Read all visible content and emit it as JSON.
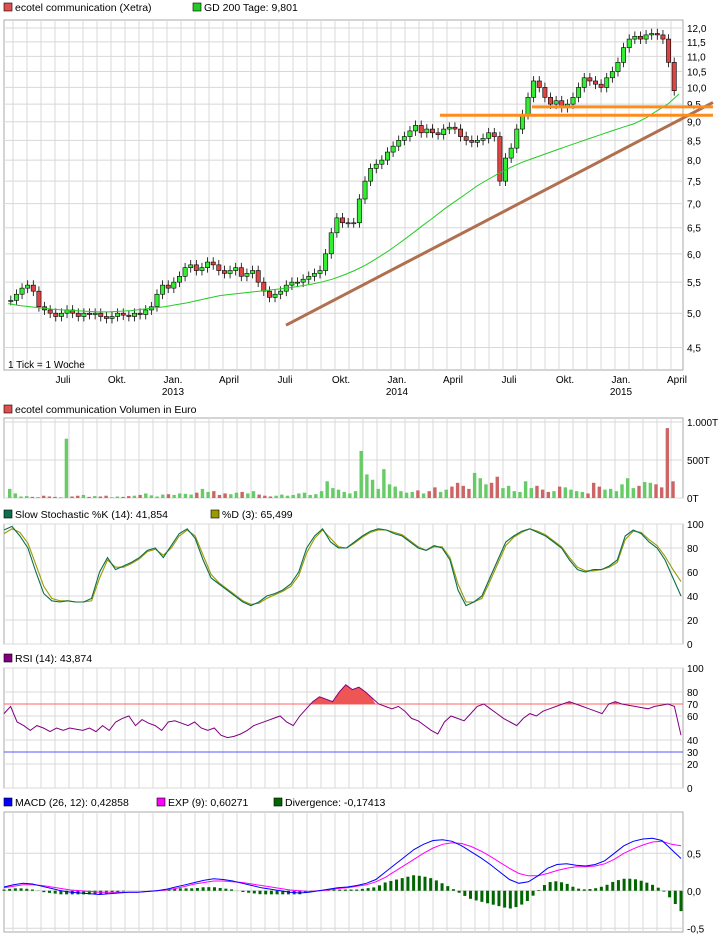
{
  "chart_data": [
    {
      "id": "price",
      "type": "candlestick",
      "legend": [
        {
          "label": "ecotel communication (Xetra)",
          "color": "#e05050"
        },
        {
          "label": "GD 200 Tage: 9,801",
          "color": "#22cc22"
        }
      ],
      "footnote": "1 Tick = 1 Woche",
      "y_scale": "log",
      "ylim": [
        4.2,
        12.3
      ],
      "y_ticks": [
        "12,0",
        "11,5",
        "11,0",
        "10,5",
        "10,0",
        "9,5",
        "9,0",
        "8,5",
        "8,0",
        "7,5",
        "7,0",
        "6,5",
        "6,0",
        "5,5",
        "5,0",
        "4,5"
      ],
      "x_month_labels": [
        "Juli",
        "Okt.",
        "Jan.",
        "April",
        "Juli",
        "Okt.",
        "Jan.",
        "April",
        "Juli",
        "Okt.",
        "Jan.",
        "April"
      ],
      "x_year_labels": [
        "2013",
        "2014",
        "2015"
      ],
      "close_series": [
        5.2,
        5.3,
        5.4,
        5.45,
        5.35,
        5.1,
        5.05,
        5.0,
        4.95,
        5.0,
        5.05,
        5.0,
        4.95,
        5.0,
        4.98,
        5.0,
        4.95,
        4.92,
        4.95,
        5.0,
        4.97,
        4.95,
        5.0,
        4.98,
        5.05,
        5.1,
        5.3,
        5.45,
        5.4,
        5.5,
        5.6,
        5.75,
        5.8,
        5.7,
        5.75,
        5.85,
        5.8,
        5.7,
        5.65,
        5.7,
        5.75,
        5.6,
        5.65,
        5.7,
        5.5,
        5.35,
        5.25,
        5.3,
        5.35,
        5.45,
        5.5,
        5.5,
        5.55,
        5.6,
        5.65,
        5.7,
        6.0,
        6.4,
        6.7,
        6.6,
        6.6,
        6.6,
        7.1,
        7.5,
        7.8,
        7.9,
        8.0,
        8.2,
        8.35,
        8.5,
        8.6,
        8.75,
        8.9,
        8.7,
        8.8,
        8.7,
        8.65,
        8.8,
        8.85,
        8.8,
        8.6,
        8.5,
        8.45,
        8.5,
        8.55,
        8.7,
        8.6,
        7.5,
        8.05,
        8.3,
        8.8,
        9.2,
        9.7,
        10.2,
        10.0,
        9.7,
        9.5,
        9.6,
        9.4,
        9.5,
        9.7,
        10.0,
        10.3,
        10.2,
        10.1,
        10.0,
        10.3,
        10.5,
        10.8,
        11.3,
        11.6,
        11.7,
        11.6,
        11.75,
        11.8,
        11.75,
        11.6,
        10.8,
        9.9
      ],
      "gd200_series": [
        5.15,
        5.12,
        5.1,
        5.08,
        5.06,
        5.05,
        5.04,
        5.03,
        5.02,
        5.02,
        5.03,
        5.04,
        5.06,
        5.08,
        5.1,
        5.13,
        5.16,
        5.2,
        5.24,
        5.28,
        5.3,
        5.32,
        5.34,
        5.36,
        5.38,
        5.4,
        5.43,
        5.46,
        5.5,
        5.55,
        5.62,
        5.7,
        5.8,
        5.92,
        6.05,
        6.2,
        6.36,
        6.53,
        6.7,
        6.88,
        7.05,
        7.22,
        7.4,
        7.55,
        7.7,
        7.83,
        7.95,
        8.05,
        8.15,
        8.25,
        8.35,
        8.45,
        8.55,
        8.65,
        8.75,
        8.85,
        8.95,
        9.1,
        9.3,
        9.5,
        9.8
      ],
      "annotations": [
        {
          "label": "support-1",
          "x0": 0.0,
          "y0": 4.8,
          "x1": 1.0,
          "y1": 9.2
        },
        {
          "label": "resistance-1",
          "y": 9.2
        },
        {
          "label": "resistance-2",
          "y": 9.4
        }
      ]
    },
    {
      "id": "volume",
      "type": "bar",
      "legend": [
        {
          "label": "ecotel communication Volumen in Euro",
          "color": "#e05050"
        }
      ],
      "y_ticks": [
        "1.000T",
        "500T",
        "0T"
      ],
      "ylim": [
        0,
        1000
      ],
      "values": [
        120,
        60,
        20,
        25,
        15,
        10,
        30,
        20,
        15,
        10,
        780,
        20,
        30,
        40,
        15,
        25,
        20,
        30,
        10,
        20,
        15,
        25,
        30,
        40,
        60,
        35,
        20,
        45,
        50,
        40,
        60,
        55,
        45,
        70,
        120,
        80,
        90,
        40,
        60,
        50,
        70,
        80,
        60,
        90,
        45,
        30,
        20,
        30,
        45,
        30,
        40,
        60,
        70,
        40,
        50,
        90,
        220,
        130,
        110,
        80,
        60,
        90,
        620,
        310,
        240,
        120,
        380,
        180,
        150,
        90,
        70,
        80,
        100,
        60,
        90,
        140,
        80,
        110,
        150,
        200,
        160,
        120,
        330,
        260,
        180,
        200,
        280,
        130,
        160,
        90,
        80,
        220,
        130,
        160,
        110,
        80,
        90,
        150,
        140,
        110,
        90,
        80,
        60,
        200,
        150,
        110,
        120,
        90,
        180,
        260,
        130,
        160,
        210,
        200,
        180,
        140,
        920,
        220
      ],
      "colors_up": "#66cc66",
      "colors_down": "#cc6666"
    },
    {
      "id": "stochastic",
      "type": "line",
      "legend": [
        {
          "label": "Slow Stochastic %K (14): 41,854",
          "color": "#0b6e4f"
        },
        {
          "label": "%D (3): 65,499",
          "color": "#999900"
        }
      ],
      "ylim": [
        0,
        100
      ],
      "y_ticks": [
        "100",
        "80",
        "60",
        "40",
        "20",
        "0"
      ],
      "k_series": [
        95,
        98,
        90,
        80,
        60,
        42,
        36,
        35,
        36,
        35,
        35,
        38,
        60,
        72,
        62,
        65,
        68,
        72,
        78,
        80,
        72,
        82,
        92,
        96,
        88,
        70,
        55,
        50,
        45,
        40,
        35,
        32,
        35,
        40,
        42,
        45,
        50,
        60,
        80,
        90,
        96,
        85,
        80,
        80,
        85,
        90,
        94,
        96,
        95,
        92,
        90,
        85,
        80,
        78,
        82,
        80,
        70,
        45,
        32,
        35,
        40,
        55,
        70,
        85,
        90,
        94,
        96,
        93,
        90,
        85,
        80,
        70,
        62,
        60,
        62,
        62,
        65,
        70,
        90,
        95,
        92,
        85,
        80,
        70,
        55,
        40
      ],
      "d_series": [
        92,
        96,
        93,
        84,
        66,
        48,
        38,
        36,
        36,
        35,
        35,
        36,
        55,
        70,
        64,
        64,
        67,
        71,
        77,
        79,
        74,
        80,
        90,
        95,
        90,
        74,
        58,
        51,
        46,
        41,
        36,
        33,
        34,
        38,
        41,
        44,
        48,
        57,
        76,
        88,
        95,
        88,
        81,
        80,
        84,
        89,
        93,
        95,
        95,
        93,
        91,
        86,
        81,
        78,
        81,
        81,
        72,
        50,
        35,
        35,
        38,
        52,
        67,
        82,
        89,
        93,
        96,
        94,
        91,
        86,
        81,
        72,
        64,
        61,
        61,
        62,
        64,
        68,
        87,
        94,
        93,
        87,
        82,
        73,
        62,
        52
      ]
    },
    {
      "id": "rsi",
      "type": "line",
      "legend": [
        {
          "label": "RSI (14): 43,874",
          "color": "#800080"
        }
      ],
      "ylim": [
        0,
        100
      ],
      "y_ticks": [
        "100",
        "80",
        "70",
        "60",
        "40",
        "30",
        "20",
        "0"
      ],
      "upper_band": 70,
      "lower_band": 30,
      "series": [
        62,
        68,
        55,
        52,
        48,
        52,
        50,
        47,
        50,
        48,
        50,
        49,
        48,
        50,
        47,
        52,
        48,
        55,
        58,
        60,
        52,
        57,
        54,
        52,
        48,
        55,
        56,
        54,
        52,
        55,
        50,
        48,
        50,
        44,
        42,
        43,
        45,
        48,
        52,
        54,
        56,
        58,
        60,
        55,
        52,
        60,
        66,
        72,
        76,
        74,
        72,
        80,
        86,
        82,
        84,
        80,
        75,
        70,
        68,
        66,
        68,
        64,
        58,
        56,
        52,
        48,
        45,
        55,
        60,
        58,
        56,
        62,
        68,
        70,
        66,
        62,
        58,
        55,
        52,
        58,
        62,
        60,
        64,
        66,
        68,
        70,
        72,
        70,
        68,
        66,
        64,
        62,
        70,
        72,
        70,
        69,
        68,
        67,
        66,
        68,
        69,
        70,
        68,
        44
      ]
    },
    {
      "id": "macd",
      "type": "line",
      "legend": [
        {
          "label": "MACD (26, 12): 0,42858",
          "color": "#0000ff"
        },
        {
          "label": "EXP (9): 0,60271",
          "color": "#ff00ff"
        },
        {
          "label": "Divergence: -0,17413",
          "color": "#006600"
        }
      ],
      "ylim": [
        -0.55,
        1.05
      ],
      "y_ticks": [
        "0,5",
        "0,0",
        "-0,5"
      ],
      "macd_series": [
        0.05,
        0.08,
        0.1,
        0.09,
        0.06,
        0.03,
        0.0,
        -0.02,
        -0.03,
        -0.04,
        -0.05,
        -0.04,
        -0.03,
        -0.02,
        -0.02,
        -0.01,
        0.0,
        0.02,
        0.05,
        0.08,
        0.11,
        0.14,
        0.16,
        0.15,
        0.13,
        0.1,
        0.07,
        0.04,
        0.02,
        0.0,
        -0.02,
        -0.03,
        -0.02,
        0.0,
        0.02,
        0.04,
        0.05,
        0.07,
        0.1,
        0.15,
        0.25,
        0.35,
        0.45,
        0.55,
        0.62,
        0.67,
        0.68,
        0.66,
        0.6,
        0.52,
        0.44,
        0.35,
        0.25,
        0.15,
        0.1,
        0.12,
        0.2,
        0.3,
        0.35,
        0.36,
        0.34,
        0.33,
        0.35,
        0.4,
        0.5,
        0.6,
        0.66,
        0.69,
        0.7,
        0.67,
        0.55,
        0.43
      ],
      "exp_series": [
        0.04,
        0.06,
        0.08,
        0.08,
        0.07,
        0.05,
        0.03,
        0.01,
        0.0,
        -0.01,
        -0.02,
        -0.02,
        -0.02,
        -0.02,
        -0.02,
        -0.01,
        0.0,
        0.01,
        0.03,
        0.06,
        0.09,
        0.11,
        0.13,
        0.13,
        0.12,
        0.11,
        0.09,
        0.07,
        0.05,
        0.03,
        0.01,
        0.0,
        -0.01,
        0.0,
        0.01,
        0.03,
        0.04,
        0.06,
        0.08,
        0.12,
        0.18,
        0.26,
        0.34,
        0.42,
        0.5,
        0.57,
        0.62,
        0.64,
        0.63,
        0.59,
        0.53,
        0.46,
        0.38,
        0.3,
        0.23,
        0.2,
        0.2,
        0.23,
        0.27,
        0.3,
        0.32,
        0.32,
        0.33,
        0.36,
        0.42,
        0.5,
        0.56,
        0.61,
        0.65,
        0.66,
        0.62,
        0.6
      ]
    }
  ]
}
